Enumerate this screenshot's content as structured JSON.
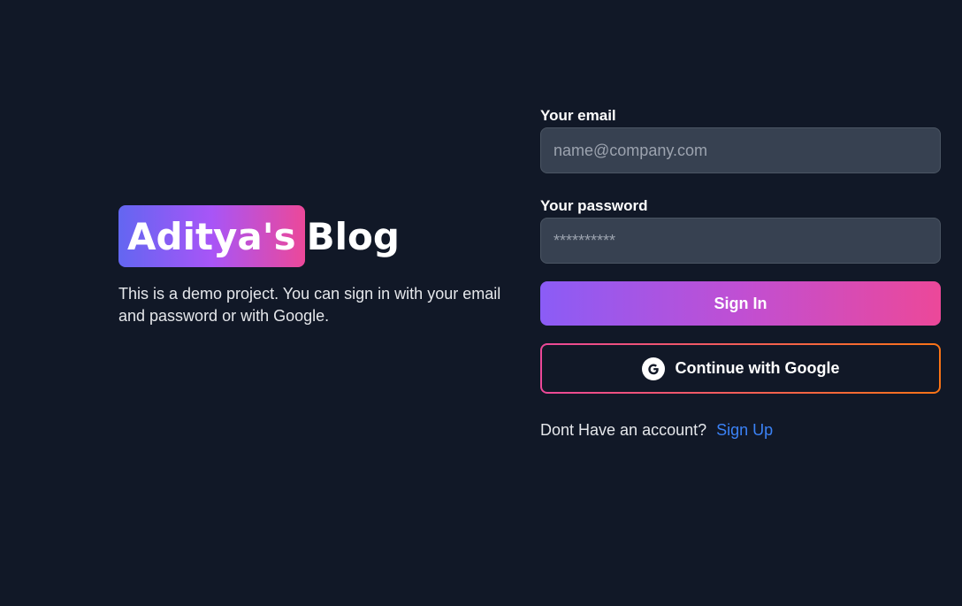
{
  "brand": {
    "logo_highlight": "Aditya's",
    "logo_rest": "Blog",
    "description": "This is a demo project. You can sign in with your email and password or with Google."
  },
  "form": {
    "email_label": "Your email",
    "email_placeholder": "name@company.com",
    "password_label": "Your password",
    "password_placeholder": "**********",
    "sign_in_label": "Sign In",
    "google_label": "Continue with Google",
    "google_icon": "google-icon",
    "signup_prompt": "Dont Have an account?",
    "signup_link": "Sign Up"
  },
  "colors": {
    "background": "#111827",
    "input_bg": "#374151",
    "link": "#3b82f6",
    "gradient_start": "#6366f1",
    "gradient_end": "#ec4899"
  }
}
